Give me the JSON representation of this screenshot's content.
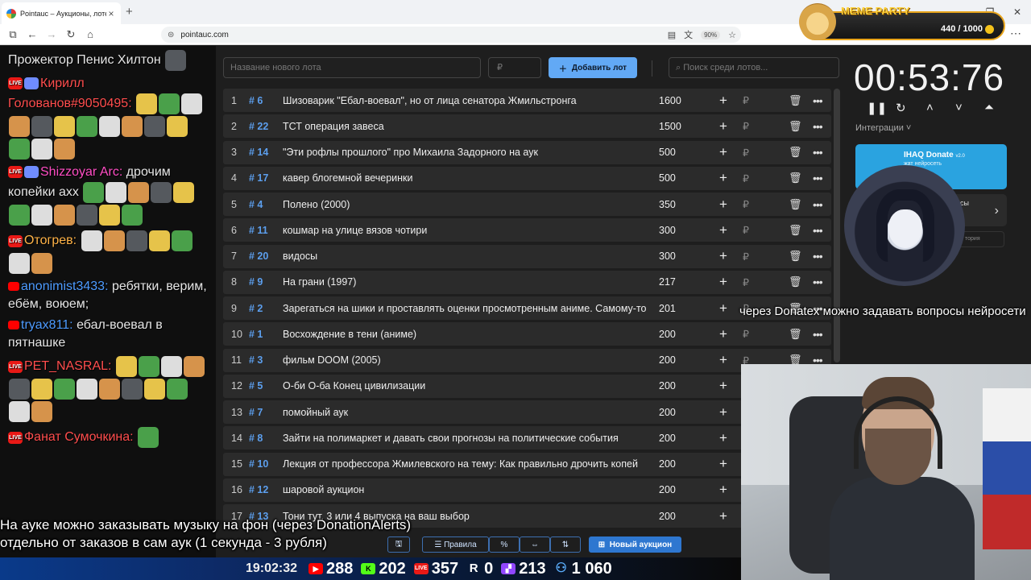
{
  "browser": {
    "tab_title": "Pointauc – Аукционы, лотереи",
    "url": "pointauc.com",
    "zoom": "90%"
  },
  "meme_party": {
    "title": "MEME PARTY",
    "counter": "440 / 1000"
  },
  "chat": [
    {
      "text": "Прожектор Пенис Хилтон",
      "name_color": "#ffffff",
      "badges": [],
      "emotes": 1
    },
    {
      "user": "Кирилл Голованов#9050495:",
      "name_color": "#ff4d4d",
      "badges": [
        "LIVE",
        "b2"
      ],
      "text": "",
      "emotes": 14
    },
    {
      "user": "Shizzoyar Arc:",
      "name_color": "#ff4dc4",
      "badges": [
        "LIVE",
        "b2"
      ],
      "text": "дрочим копейки ахх",
      "emotes": 11
    },
    {
      "user": "Отогрев:",
      "name_color": "#ffb347",
      "badges": [
        "LIVE"
      ],
      "text": "",
      "emotes": 7
    },
    {
      "user": "anonimist3433:",
      "name_color": "#4d9bff",
      "badges": [
        "YT"
      ],
      "text": "ребятки, верим, ебём, воюем;",
      "emotes": 0
    },
    {
      "user": "tryax811:",
      "name_color": "#4d9bff",
      "badges": [
        "YT"
      ],
      "text": "ебал-воевал в пятнашке",
      "emotes": 0
    },
    {
      "user": "PET_NASRAL:",
      "name_color": "#ff4d4d",
      "badges": [
        "LIVE"
      ],
      "text": "",
      "emotes": 14
    },
    {
      "user": "Фанат Сумочкина:",
      "name_color": "#ff4d4d",
      "badges": [
        "LIVE"
      ],
      "text": "",
      "emotes": 1
    }
  ],
  "lot_form": {
    "name_placeholder": "Название нового лота",
    "currency_placeholder": "₽",
    "add_button": "Добавить лот",
    "search_placeholder": "Поиск среди лотов..."
  },
  "lots": [
    {
      "n": "1",
      "id": "# 6",
      "name": "Шизоварик \"Ебал-воевал\", но от лица сенатора Жмильстронга",
      "amount": "1600"
    },
    {
      "n": "2",
      "id": "# 22",
      "name": "ТСТ операция завеса",
      "amount": "1500"
    },
    {
      "n": "3",
      "id": "# 14",
      "name": "\"Эти рофлы прошлого\" про Михаила Задорного на аук",
      "amount": "500"
    },
    {
      "n": "4",
      "id": "# 17",
      "name": "кавер блогемной вечеринки",
      "amount": "500"
    },
    {
      "n": "5",
      "id": "# 4",
      "name": "Полено (2000)",
      "amount": "350"
    },
    {
      "n": "6",
      "id": "# 11",
      "name": "кошмар на улице вязов чотири",
      "amount": "300"
    },
    {
      "n": "7",
      "id": "# 20",
      "name": "видосы",
      "amount": "300"
    },
    {
      "n": "8",
      "id": "# 9",
      "name": "На грани (1997)",
      "amount": "217"
    },
    {
      "n": "9",
      "id": "# 2",
      "name": "Зарегаться на шики и проставлять оценки просмотренным аниме. Самому-то",
      "amount": "201"
    },
    {
      "n": "10",
      "id": "# 1",
      "name": "Восхождение в тени (аниме)",
      "amount": "200"
    },
    {
      "n": "11",
      "id": "# 3",
      "name": "фильм DOOM (2005)",
      "amount": "200"
    },
    {
      "n": "12",
      "id": "# 5",
      "name": "О-би О-ба Конец цивилизации",
      "amount": "200"
    },
    {
      "n": "13",
      "id": "# 7",
      "name": "помойный аук",
      "amount": "200"
    },
    {
      "n": "14",
      "id": "# 8",
      "name": "Зайти на полимаркет и давать свои прогнозы на политические события",
      "amount": "200"
    },
    {
      "n": "15",
      "id": "# 10",
      "name": "Лекция от профессора Жмилевского на тему: Как правильно дрочить копей",
      "amount": "200"
    },
    {
      "n": "16",
      "id": "# 12",
      "name": "шаровой аукцион",
      "amount": "200"
    },
    {
      "n": "17",
      "id": "# 13",
      "name": "Тони тут, 3 или 4 выпуска на ваш выбор",
      "amount": "200"
    }
  ],
  "toolbar": {
    "rules": "Правила",
    "percent": "%",
    "new_auction": "Новый аукцион"
  },
  "timer": {
    "value": "00:53:76",
    "integrations": "Интеграции"
  },
  "donate": {
    "title": "IHAQ Donate",
    "version": "v2.0",
    "sub": "жат нейросеть",
    "card_text": "сы",
    "history": "тория"
  },
  "hint": "через Donatex можно задавать вопросы нейросети",
  "caption": [
    "На ауке можно заказывать музыку на фон (через DonationAlerts)",
    "отдельно от заказов в сам аук (1 секунда - 3 рубля)"
  ],
  "stats": {
    "clock": "19:02:32",
    "youtube": "288",
    "kick": "202",
    "live": "357",
    "r": "0",
    "twitch": "213",
    "total": "1 060"
  },
  "colors": {
    "accent": "#62a9f5",
    "id": "#5c9fee",
    "row": "#2b2b2b"
  }
}
